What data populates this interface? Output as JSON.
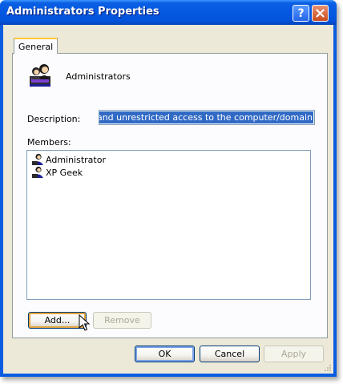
{
  "window": {
    "title": "Administrators Properties",
    "help_label": "?",
    "close_label": "✕"
  },
  "tabs": [
    {
      "label": "General"
    }
  ],
  "group": {
    "name": "Administrators",
    "icon": "group-users-icon"
  },
  "description": {
    "label": "Description:",
    "value": "mplete and unrestricted access to the computer/domain"
  },
  "members": {
    "label": "Members:",
    "items": [
      {
        "name": "Administrator",
        "icon": "user-icon"
      },
      {
        "name": "XP Geek",
        "icon": "user-icon"
      }
    ]
  },
  "buttons": {
    "add": "Add...",
    "remove": "Remove",
    "ok": "OK",
    "cancel": "Cancel",
    "apply": "Apply"
  },
  "colors": {
    "titlebar": "#0458e2",
    "client": "#ece9d8",
    "selection": "#316ac5",
    "tab_highlight": "#ffc83c"
  }
}
